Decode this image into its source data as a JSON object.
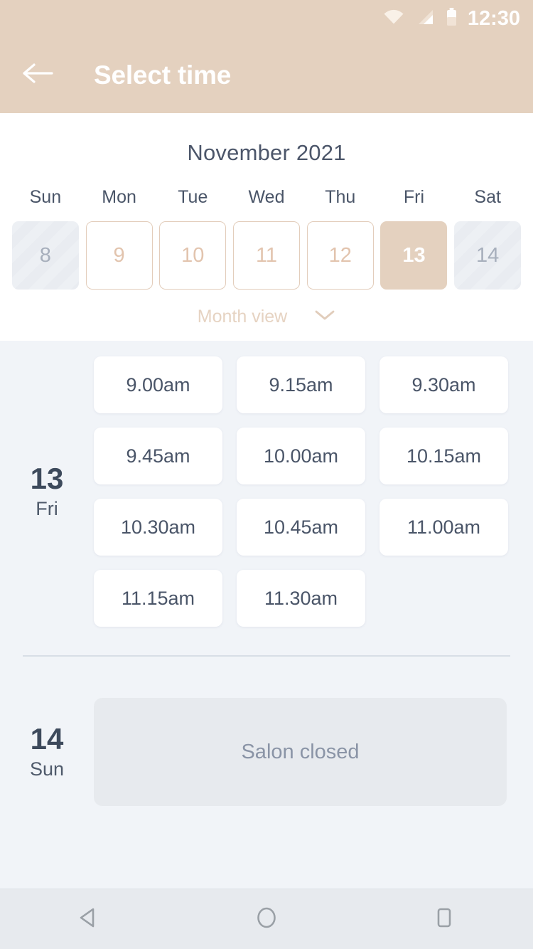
{
  "status_bar": {
    "time": "12:30",
    "icons": [
      "wifi-icon",
      "cellular-signal-icon",
      "battery-icon"
    ]
  },
  "app_bar": {
    "title": "Select time",
    "back_icon": "arrow-left-icon",
    "background_color": "#E4D1BF",
    "title_color": "#FFFFFF"
  },
  "calendar": {
    "month_title": "November 2021",
    "weekdays": [
      "Sun",
      "Mon",
      "Tue",
      "Wed",
      "Thu",
      "Fri",
      "Sat"
    ],
    "days": [
      {
        "label": "8",
        "state": "disabled"
      },
      {
        "label": "9",
        "state": "available"
      },
      {
        "label": "10",
        "state": "available"
      },
      {
        "label": "11",
        "state": "available"
      },
      {
        "label": "12",
        "state": "available"
      },
      {
        "label": "13",
        "state": "selected"
      },
      {
        "label": "14",
        "state": "disabled"
      }
    ],
    "view_toggle": {
      "label": "Month view",
      "icon": "chevron-down-icon"
    },
    "colors": {
      "accent": "#E4D1BF",
      "available_border": "#E3CDBB",
      "available_text": "#E2C4AE",
      "disabled_text": "#A7AFBC",
      "title_text": "#4C566A"
    }
  },
  "schedule": {
    "groups": [
      {
        "day_number": "13",
        "day_of_week": "Fri",
        "type": "slots",
        "slots": [
          "9.00am",
          "9.15am",
          "9.30am",
          "9.45am",
          "10.00am",
          "10.15am",
          "10.30am",
          "10.45am",
          "11.00am",
          "11.15am",
          "11.30am"
        ]
      },
      {
        "day_number": "14",
        "day_of_week": "Sun",
        "type": "closed",
        "closed_message": "Salon closed"
      }
    ],
    "colors": {
      "background": "#F1F4F8",
      "slot_background": "#FFFFFF",
      "slot_text": "#4A5568",
      "day_number_text": "#3D4A5C",
      "closed_background": "#E7EAEE",
      "closed_text": "#8A94A6"
    }
  },
  "nav_bar": {
    "buttons": [
      {
        "name": "back-triangle-icon"
      },
      {
        "name": "home-circle-icon"
      },
      {
        "name": "recents-square-icon"
      }
    ]
  }
}
